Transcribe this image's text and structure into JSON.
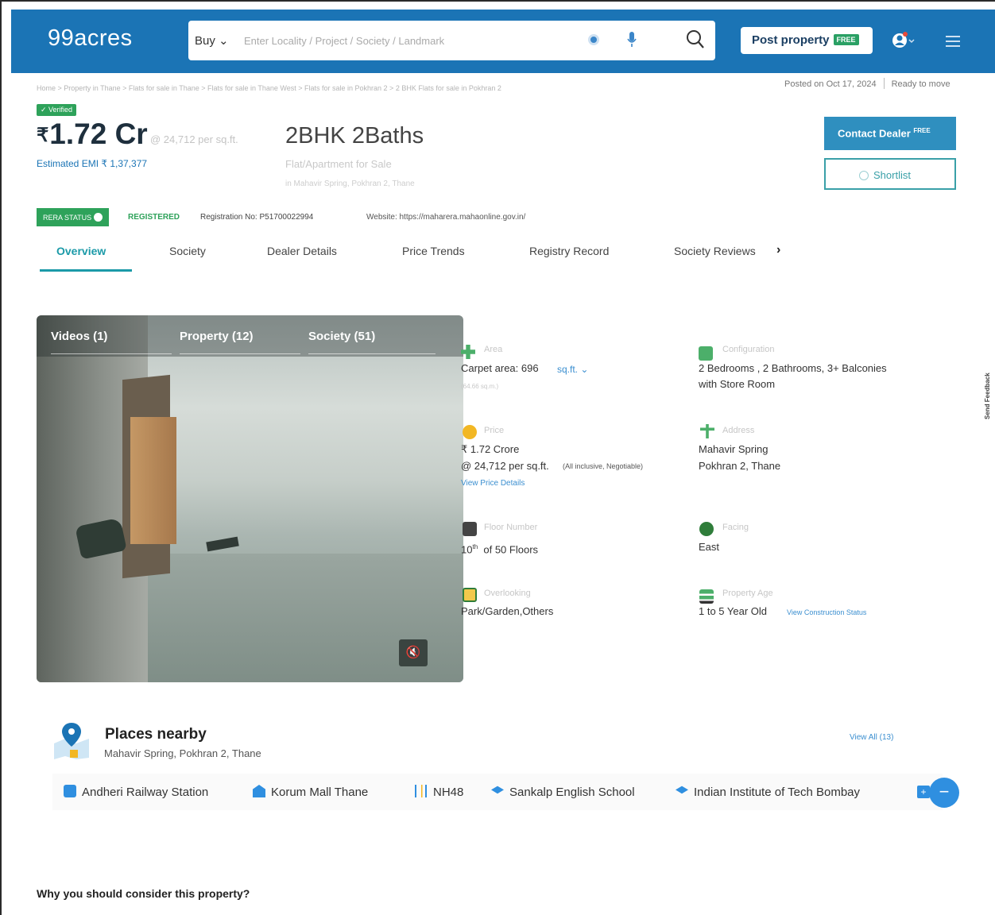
{
  "header": {
    "logo": "99acres",
    "buy_label": "Buy ⌄",
    "search_placeholder": "Enter Locality / Project / Society / Landmark",
    "post_label": "Post property",
    "post_badge": "FREE"
  },
  "breadcrumb": "Home > Property in Thane > Flats for sale in Thane > Flats for sale in Thane West > Flats for sale in Pokhran 2 > 2 BHK Flats for sale in Pokhran 2",
  "posted": {
    "date": "Posted on Oct 17, 2024",
    "status": "Ready to move"
  },
  "listing": {
    "verified": "✓ Verified",
    "price": "1.72 Cr",
    "currency": "₹",
    "per_sqft": "@ 24,712 per sq.ft.",
    "emi": "Estimated EMI ₹ 1,37,377",
    "title": "2BHK 2Baths",
    "type": "Flat/Apartment for Sale",
    "location": "in Mahavir Spring, Pokhran 2, Thane",
    "contact_label": "Contact Dealer",
    "contact_badge": "FREE",
    "shortlist_label": "Shortlist"
  },
  "rera": {
    "badge": "RERA STATUS",
    "status": "REGISTERED",
    "registration": "Registration No: P51700022994",
    "website": "Website: https://maharera.mahaonline.gov.in/"
  },
  "tabs": [
    "Overview",
    "Society",
    "Dealer Details",
    "Price Trends",
    "Registry Record",
    "Society Reviews"
  ],
  "tabs_next": "›",
  "media": {
    "tabs": [
      "Videos (1)",
      "Property (12)",
      "Society (51)"
    ],
    "mute_icon": "🔇"
  },
  "details": {
    "area_label": "Area",
    "area_value": "Carpet area: 696",
    "area_unit": "sq.ft. ⌄",
    "area_sub": "(64.66 sq.m.)",
    "config_label": "Configuration",
    "config_value1": "2 Bedrooms , 2 Bathrooms, 3+ Balconies",
    "config_value2": "with Store Room",
    "price_label": "Price",
    "price_value": "₹ 1.72 Crore",
    "price_psf": "@ 24,712 per sq.ft.",
    "price_note": "(All inclusive, Negotiable)",
    "price_link": "View Price Details",
    "address_label": "Address",
    "address_value1": "Mahavir Spring",
    "address_value2": "Pokhran 2, Thane",
    "floor_label": "Floor Number",
    "floor_value": "10",
    "floor_sup": "th",
    "floor_of": "of 50 Floors",
    "facing_label": "Facing",
    "facing_value": "East",
    "overlooking_label": "Overlooking",
    "overlooking_value": "Park/Garden,Others",
    "age_label": "Property Age",
    "age_value": "1 to 5 Year Old",
    "age_link": "View Construction Status"
  },
  "places": {
    "title": "Places nearby",
    "subtitle": "Mahavir Spring, Pokhran 2, Thane",
    "view_all": "View All (13)",
    "items": [
      "Andheri Railway Station",
      "Korum Mall Thane",
      "NH48",
      "Sankalp English School",
      "Indian Institute of Tech Bombay"
    ]
  },
  "why_title": "Why you should consider this property?",
  "feedback_label": "Send Feedback",
  "colors": {
    "header_blue": "#1b74b5",
    "teal": "#1b9aa8",
    "green": "#2ea25a",
    "link_blue": "#3b8fd0"
  }
}
